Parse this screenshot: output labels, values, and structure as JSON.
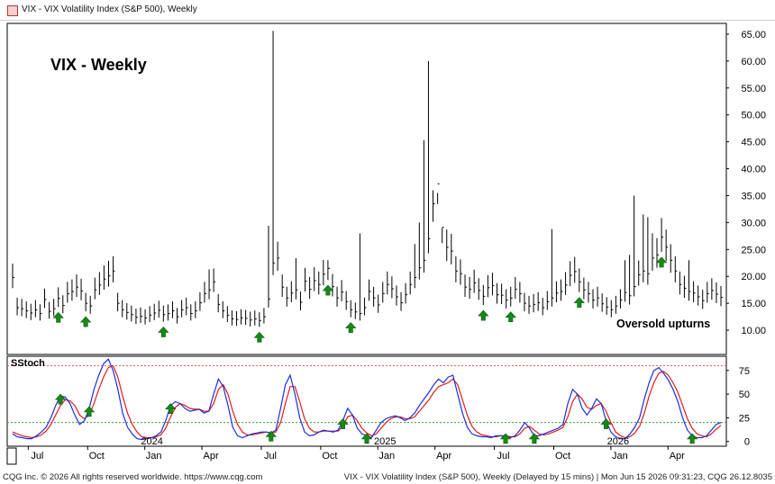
{
  "window": {
    "title": "VIX - VIX Volatility Index (S&P 500), Weekly"
  },
  "status": {
    "left": "CQG Inc. © 2026 All rights reserved worldwide. https://www.cqg.com",
    "right": "VIX - VIX Volatility Index (S&P 500), Weekly (Delayed by 15 mins) | Mon Jun 15 2026 09:31:23, CQG 26.12.8035"
  },
  "chart_data": [
    {
      "type": "line",
      "title": "VIX - Weekly",
      "annotation": "Oversold upturns",
      "y_ticks": [
        "65.00",
        "60.00",
        "55.00",
        "50.00",
        "45.00",
        "40.00",
        "35.00",
        "30.00",
        "25.00",
        "20.00",
        "15.00",
        "10.00"
      ],
      "ylim": [
        5.5,
        67.0
      ],
      "x_labels": [
        "Jul",
        "Oct",
        "2024",
        "Jan",
        "Apr",
        "Jul",
        "Oct",
        "2025",
        "Jan",
        "Apr",
        "Jul",
        "Oct",
        "2026",
        "Jan",
        "Apr"
      ],
      "x_label_weeks": [
        5,
        18,
        30.5,
        30.5,
        43,
        56,
        69,
        81.5,
        81.5,
        94,
        107,
        120,
        132.5,
        132.5,
        145
      ],
      "weeks": 156,
      "values": [
        19.8,
        14.2,
        14.0,
        13.6,
        13.2,
        13.8,
        13.1,
        15.7,
        13.5,
        14.0,
        15.9,
        14.6,
        16.8,
        17.2,
        18.0,
        17.3,
        15.0,
        14.5,
        17.5,
        18.4,
        19.5,
        20.1,
        21.0,
        15.0,
        13.8,
        13.3,
        12.9,
        12.4,
        12.6,
        12.3,
        12.8,
        13.2,
        13.7,
        12.9,
        13.1,
        13.6,
        12.5,
        13.8,
        14.2,
        13.1,
        13.6,
        15.1,
        16.8,
        17.5,
        19.0,
        14.8,
        13.6,
        12.8,
        12.1,
        12.0,
        12.3,
        12.2,
        11.9,
        12.1,
        11.8,
        12.5,
        15.8,
        22.5,
        23.4,
        18.0,
        16.0,
        16.9,
        17.5,
        15.2,
        19.1,
        17.6,
        19.2,
        18.5,
        20.4,
        21.5,
        18.1,
        16.0,
        17.1,
        15.3,
        13.8,
        13.4,
        13.1,
        14.2,
        17.2,
        16.0,
        14.7,
        16.8,
        18.5,
        17.7,
        16.2,
        15.1,
        16.6,
        18.5,
        19.8,
        21.6,
        23.0,
        27.0,
        33.5,
        37.2,
        29.1,
        25.4,
        24.7,
        21.0,
        20.5,
        18.0,
        17.6,
        18.8,
        17.4,
        16.3,
        17.9,
        18.3,
        16.6,
        16.5,
        15.6,
        16.0,
        17.6,
        16.8,
        15.0,
        14.5,
        14.8,
        15.1,
        14.2,
        15.3,
        16.0,
        16.9,
        17.2,
        18.4,
        20.2,
        20.9,
        19.0,
        17.5,
        16.8,
        15.6,
        16.0,
        14.9,
        14.3,
        13.8,
        14.5,
        15.6,
        17.0,
        16.4,
        18.1,
        20.3,
        21.0,
        20.5,
        23.4,
        24.0,
        27.3,
        25.4,
        23.0,
        21.0,
        18.5,
        17.8,
        17.2,
        16.9,
        16.2,
        15.5,
        16.8,
        17.4,
        16.7,
        16.1
      ],
      "highs": [
        null,
        null,
        null,
        null,
        null,
        null,
        null,
        null,
        null,
        null,
        null,
        null,
        null,
        null,
        null,
        null,
        null,
        null,
        null,
        null,
        null,
        22.9,
        null,
        null,
        null,
        null,
        null,
        null,
        null,
        null,
        null,
        null,
        null,
        null,
        null,
        null,
        null,
        null,
        null,
        null,
        null,
        null,
        null,
        21.3,
        null,
        null,
        null,
        null,
        null,
        null,
        null,
        null,
        null,
        null,
        null,
        null,
        29.4,
        65.6,
        null,
        null,
        null,
        null,
        23.4,
        null,
        null,
        null,
        null,
        null,
        null,
        23.0,
        null,
        null,
        null,
        null,
        null,
        null,
        28.0,
        null,
        null,
        null,
        null,
        null,
        null,
        null,
        null,
        null,
        null,
        null,
        26.0,
        30.0,
        45.3,
        60.0,
        36.0,
        35.5,
        29.0,
        null,
        null,
        null,
        null,
        null,
        null,
        null,
        null,
        null,
        null,
        null,
        null,
        null,
        null,
        null,
        null,
        null,
        null,
        null,
        null,
        null,
        null,
        null,
        28.8,
        null,
        null,
        null,
        null,
        null,
        null,
        null,
        null,
        null,
        null,
        null,
        null,
        null,
        null,
        null,
        23.0,
        24.0,
        35.0,
        null,
        31.5,
        31.0,
        28.0,
        null,
        null,
        null,
        null,
        null,
        null,
        null,
        23.0,
        null,
        null
      ],
      "upturn_arrows_weeks": [
        10,
        16,
        33,
        54,
        69,
        74,
        103,
        109,
        124,
        142
      ],
      "note": "y values in index points; weekly range bars (high/low) and close marks"
    },
    {
      "type": "line",
      "title": "SStoch",
      "y_ticks": [
        "75",
        "50",
        "25",
        "0"
      ],
      "ylim": [
        -5,
        90
      ],
      "overbought": 80,
      "oversold": 20,
      "series": [
        {
          "name": "",
          "color": "#1c2fe0",
          "values": [
            8,
            5,
            4,
            3,
            3,
            6,
            10,
            15,
            25,
            38,
            48,
            47,
            40,
            28,
            18,
            22,
            35,
            55,
            70,
            82,
            87,
            75,
            55,
            30,
            15,
            8,
            3,
            2,
            3,
            4,
            6,
            10,
            22,
            38,
            42,
            40,
            35,
            32,
            33,
            34,
            30,
            32,
            50,
            66,
            58,
            38,
            15,
            6,
            4,
            6,
            8,
            9,
            10,
            10,
            9,
            12,
            35,
            60,
            70,
            50,
            25,
            10,
            6,
            7,
            10,
            12,
            11,
            10,
            12,
            22,
            35,
            28,
            14,
            8,
            6,
            4,
            12,
            20,
            24,
            26,
            27,
            25,
            22,
            25,
            30,
            38,
            45,
            52,
            60,
            66,
            62,
            68,
            70,
            50,
            30,
            15,
            8,
            6,
            5,
            5,
            4,
            6,
            6,
            5,
            4,
            6,
            12,
            20,
            14,
            6,
            6,
            8,
            10,
            12,
            14,
            18,
            40,
            55,
            50,
            35,
            28,
            35,
            45,
            40,
            22,
            10,
            5,
            3,
            3,
            8,
            15,
            25,
            45,
            62,
            75,
            78,
            72,
            65,
            55,
            42,
            25,
            12,
            6,
            4,
            4,
            6,
            12,
            18,
            20
          ]
        },
        {
          "name": "",
          "color": "#e01c1c",
          "values": [
            10,
            8,
            6,
            5,
            4,
            5,
            7,
            11,
            18,
            28,
            38,
            44,
            43,
            38,
            28,
            24,
            28,
            40,
            55,
            68,
            78,
            80,
            68,
            48,
            30,
            18,
            10,
            5,
            4,
            4,
            5,
            7,
            14,
            26,
            36,
            40,
            38,
            35,
            34,
            34,
            32,
            32,
            40,
            55,
            60,
            50,
            32,
            18,
            10,
            7,
            7,
            8,
            9,
            10,
            9,
            10,
            20,
            40,
            58,
            58,
            42,
            24,
            14,
            10,
            10,
            11,
            11,
            11,
            11,
            16,
            26,
            28,
            22,
            14,
            9,
            6,
            8,
            14,
            20,
            24,
            26,
            26,
            24,
            24,
            26,
            32,
            38,
            44,
            52,
            58,
            60,
            62,
            66,
            60,
            44,
            28,
            16,
            10,
            7,
            6,
            5,
            5,
            6,
            6,
            5,
            5,
            8,
            14,
            16,
            12,
            8,
            7,
            8,
            10,
            12,
            15,
            26,
            42,
            50,
            45,
            36,
            34,
            38,
            40,
            32,
            20,
            10,
            6,
            4,
            5,
            9,
            16,
            30,
            48,
            62,
            72,
            74,
            70,
            62,
            52,
            38,
            24,
            14,
            8,
            6,
            5,
            8,
            13,
            17
          ]
        }
      ],
      "upturn_arrows_weeks": [
        10,
        16,
        33,
        54,
        69,
        74,
        103,
        109,
        124,
        142
      ]
    }
  ]
}
